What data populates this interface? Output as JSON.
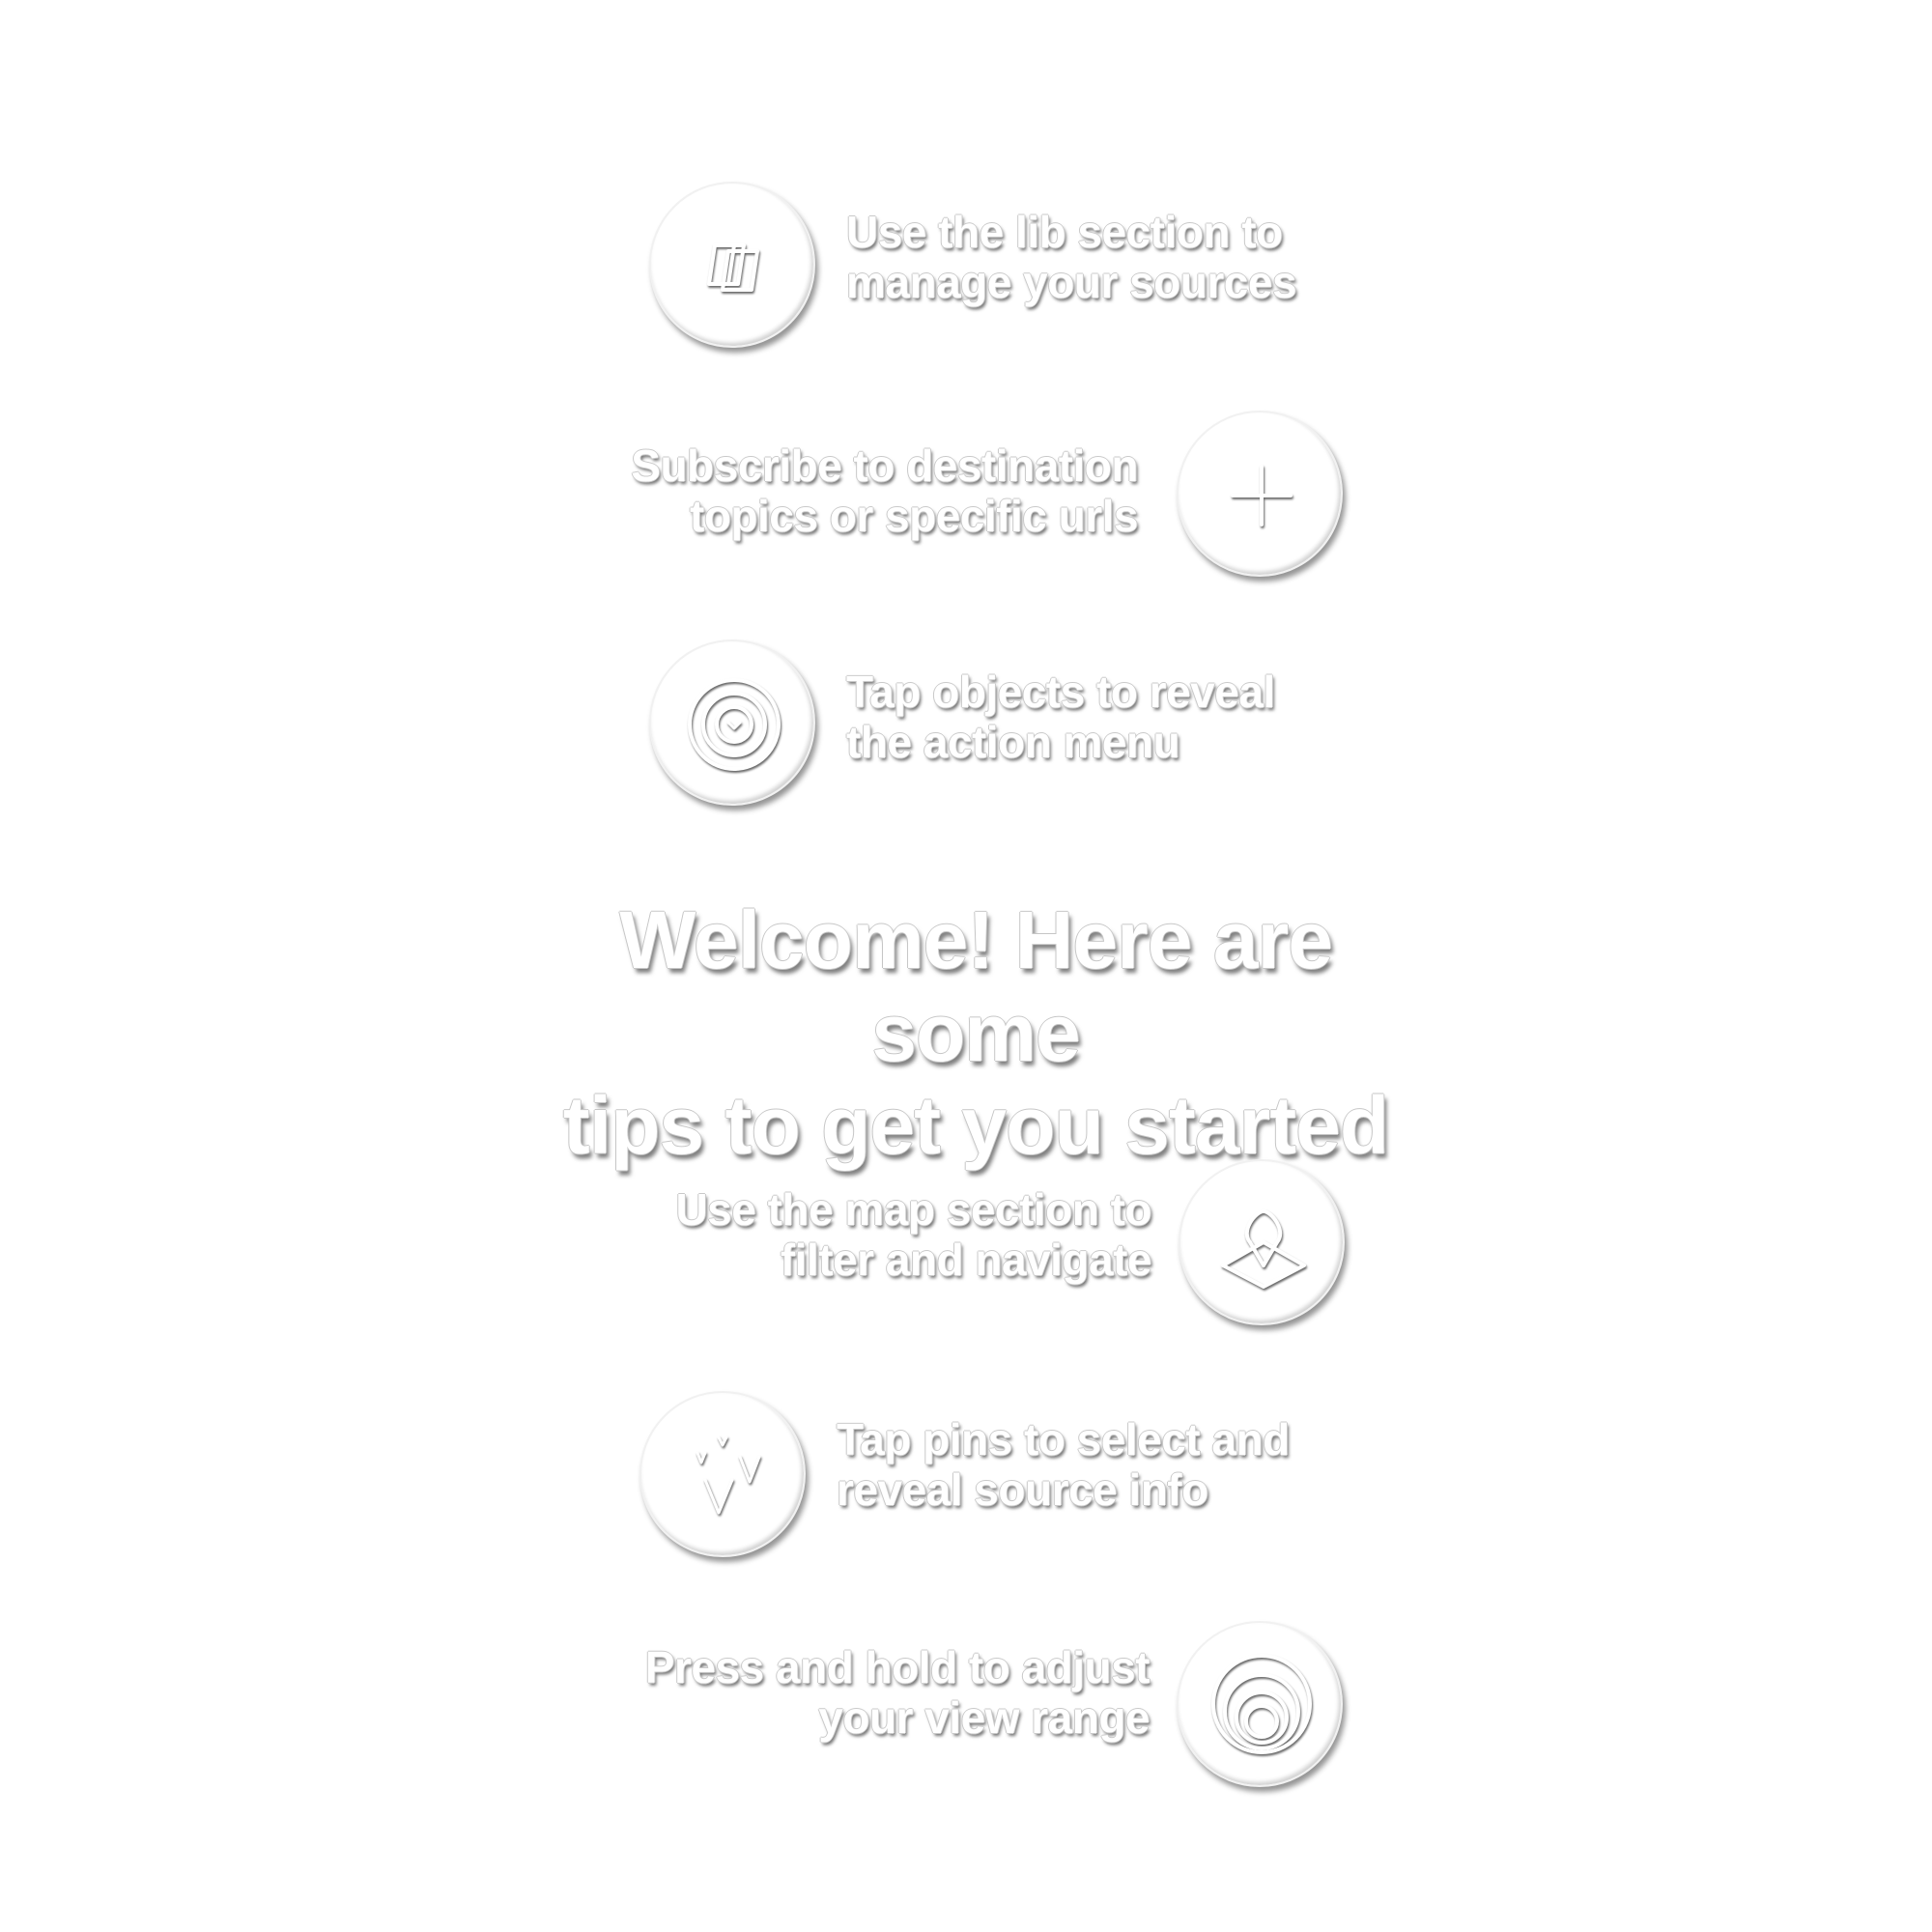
{
  "welcome": {
    "line1": "Welcome! Here are some",
    "line2": "tips to get you started"
  },
  "tips": [
    {
      "icon": "library-icon",
      "line1": "Use the lib section to",
      "line2": "manage your sources"
    },
    {
      "icon": "plus-icon",
      "line1": "Subscribe to destination",
      "line2": "topics or specific urls"
    },
    {
      "icon": "target-icon",
      "line1": "Tap objects to reveal",
      "line2": "the action menu"
    },
    {
      "icon": "map-pin-icon",
      "line1": "Use the map section to",
      "line2": "filter and navigate"
    },
    {
      "icon": "pins-icon",
      "line1": "Tap pins to select and",
      "line2": "reveal source info"
    },
    {
      "icon": "range-icon",
      "line1": "Press and hold to adjust",
      "line2": "your view range"
    }
  ]
}
